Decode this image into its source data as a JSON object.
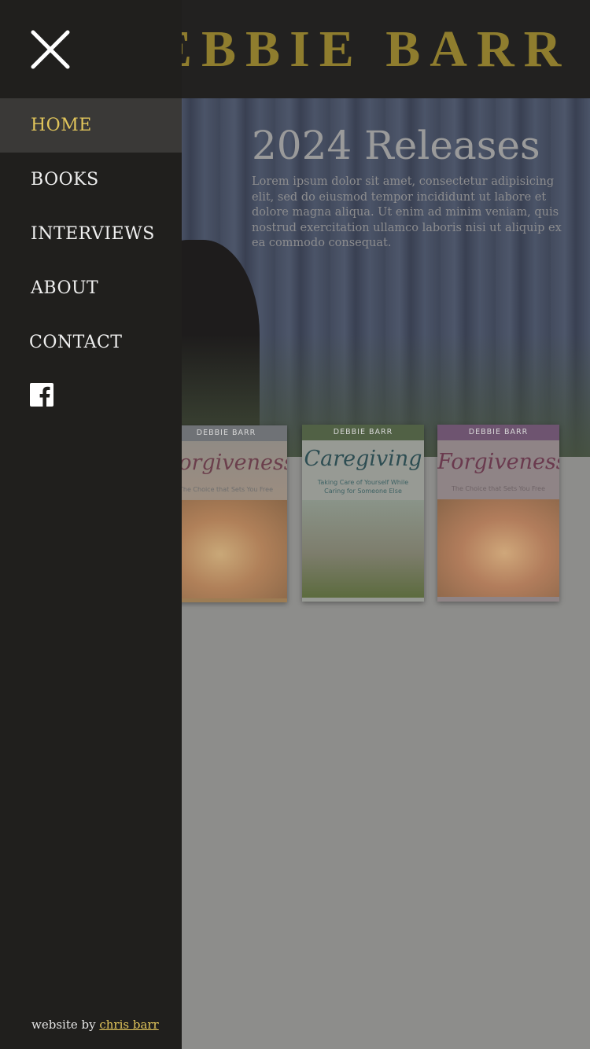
{
  "header": {
    "site_title": "EBBIE BARR"
  },
  "hero": {
    "heading": "2024 Releases",
    "text": "Lorem ipsum dolor sit amet, consectetur adipisicing elit, sed do eiusmod tempor incididunt ut labore et dolore magna aliqua. Ut enim ad minim veniam, quis nostrud exercitation ullamco laboris nisi ut aliquip ex ea commodo consequat."
  },
  "books": [
    {
      "author": "DEBBIE BARR",
      "title": "Forgiveness",
      "subtitle": "The Choice that Sets You Free"
    },
    {
      "author": "DEBBIE BARR",
      "title": "Caregiving",
      "subtitle": "Taking Care of Yourself While Caring for Someone Else"
    },
    {
      "author": "DEBBIE BARR",
      "title": "Forgiveness",
      "subtitle": "The Choice that Sets You Free"
    }
  ],
  "menu": {
    "close_icon": "close-icon",
    "items": [
      {
        "label": "HOME",
        "active": true
      },
      {
        "label": "BOOKS",
        "active": false
      },
      {
        "label": "INTERVIEWS",
        "active": false
      },
      {
        "label": "ABOUT",
        "active": false
      },
      {
        "label": "CONTACT",
        "active": false
      }
    ],
    "social_icon": "facebook-icon"
  },
  "footer": {
    "credit_prefix": "website by",
    "credit_link": "chris barr"
  },
  "colors": {
    "sidebar_bg": "#201f1d",
    "active_item_bg": "#3a3937",
    "accent_gold": "#e2c65b",
    "title_gold": "#8f7d2e"
  }
}
